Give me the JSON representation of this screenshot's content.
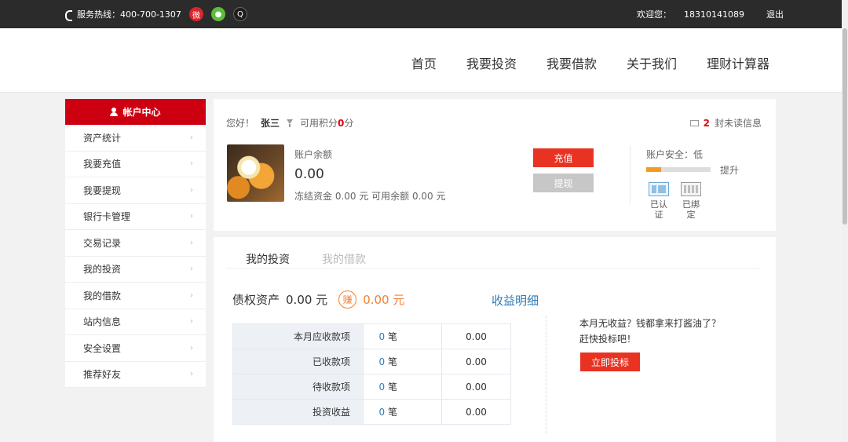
{
  "topbar": {
    "hotline": "服务热线：400-700-1307",
    "social": [
      {
        "icon": "weibo-icon",
        "glyph": "微"
      },
      {
        "icon": "wechat-icon",
        "glyph": "●"
      },
      {
        "icon": "qq-icon",
        "glyph": "Q"
      }
    ],
    "welcome": "欢迎您：",
    "phone": "18310141089",
    "logout": "退出"
  },
  "nav": [
    "首页",
    "我要投资",
    "我要借款",
    "关于我们",
    "理财计算器"
  ],
  "sidebar": {
    "title": "帐户中心",
    "items": [
      "资产统计",
      "我要充值",
      "我要提现",
      "银行卡管理",
      "交易记录",
      "我的投资",
      "我的借款",
      "站内信息",
      "安全设置",
      "推荐好友"
    ]
  },
  "account": {
    "greeting": "您好！",
    "name": "张三",
    "points_label": "可用积分",
    "points": "0",
    "points_unit": "分",
    "unread_count": "2",
    "unread_label": "封未读信息",
    "balance_label": "账户余额",
    "balance": "0.00",
    "balance_detail": "冻结资金 0.00 元 可用余额 0.00 元",
    "recharge": "充值",
    "withdraw": "提现",
    "security_label": "账户安全：低",
    "security_level": 0.25,
    "upgrade": "提升",
    "badge_verified": "已认证",
    "badge_bound": "已绑定"
  },
  "invest": {
    "tabs": [
      "我的投资",
      "我的借款"
    ],
    "assets_label": "债权资产",
    "assets_value": "0.00 元",
    "earn_icon": "赚",
    "earn_value": "0.00 元",
    "detail_link": "收益明细",
    "rows": [
      {
        "label": "本月应收款项",
        "count": "0",
        "unit": "笔",
        "amount": "0.00"
      },
      {
        "label": "已收款项",
        "count": "0",
        "unit": "笔",
        "amount": "0.00"
      },
      {
        "label": "待收款项",
        "count": "0",
        "unit": "笔",
        "amount": "0.00"
      },
      {
        "label": "投资收益",
        "count": "0",
        "unit": "笔",
        "amount": "0.00"
      }
    ],
    "no_income_line1": "本月无收益？钱都拿来打酱油了？",
    "no_income_line2": "赶快投标吧！",
    "invest_button": "立即投标"
  }
}
